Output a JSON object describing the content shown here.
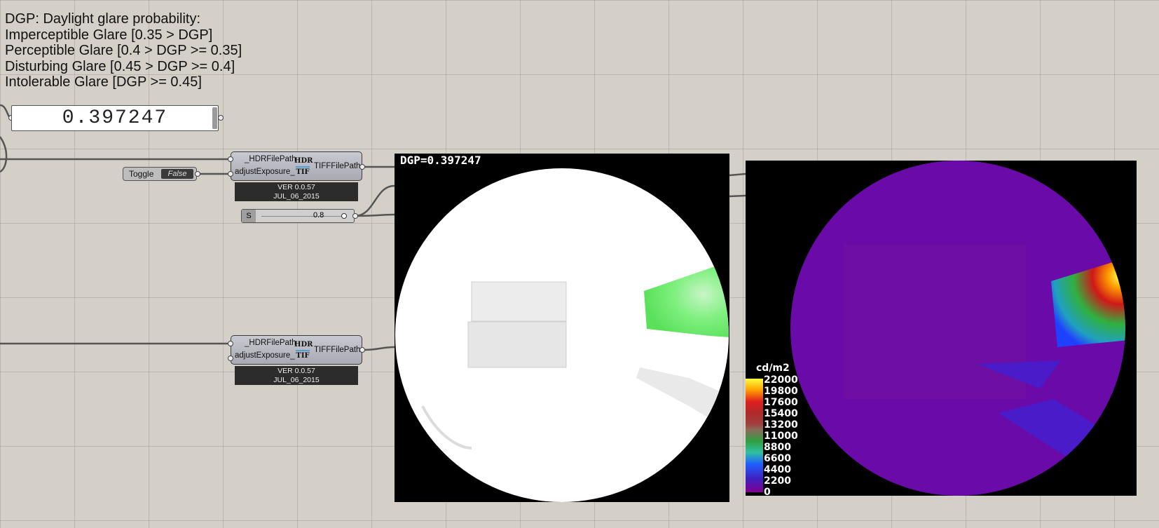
{
  "note": {
    "lines": [
      "DGP: Daylight glare probability:",
      "Imperceptible Glare [0.35 > DGP]",
      "Perceptible Glare [0.4 > DGP >= 0.35]",
      "Disturbing Glare [0.45 > DGP >= 0.4]",
      "Intolerable Glare [DGP >= 0.45]"
    ]
  },
  "panel": {
    "value": "0.397247"
  },
  "toggle": {
    "label": "Toggle",
    "value": "False"
  },
  "component1": {
    "input1": "_HDRFilePath",
    "input2": "adjustExposure_",
    "icon_top": "HDR",
    "icon_bottom": "TIF",
    "output": "TIFFFilePath",
    "version": "VER 0.0.57",
    "date": "JUL_06_2015"
  },
  "component2": {
    "input1": "_HDRFilePath",
    "input2": "adjustExposure_",
    "icon_top": "HDR",
    "icon_bottom": "TIF",
    "output": "TIFFFilePath",
    "version": "VER 0.0.57",
    "date": "JUL_06_2015"
  },
  "slider": {
    "label": "S",
    "value": "0.8"
  },
  "image1": {
    "overlay": "DGP=0.397247"
  },
  "image2": {
    "legend_unit": "cd/m2",
    "legend_values": [
      "22000",
      "19800",
      "17600",
      "15400",
      "13200",
      "11000",
      "8800",
      "6600",
      "4400",
      "2200",
      "0"
    ]
  }
}
